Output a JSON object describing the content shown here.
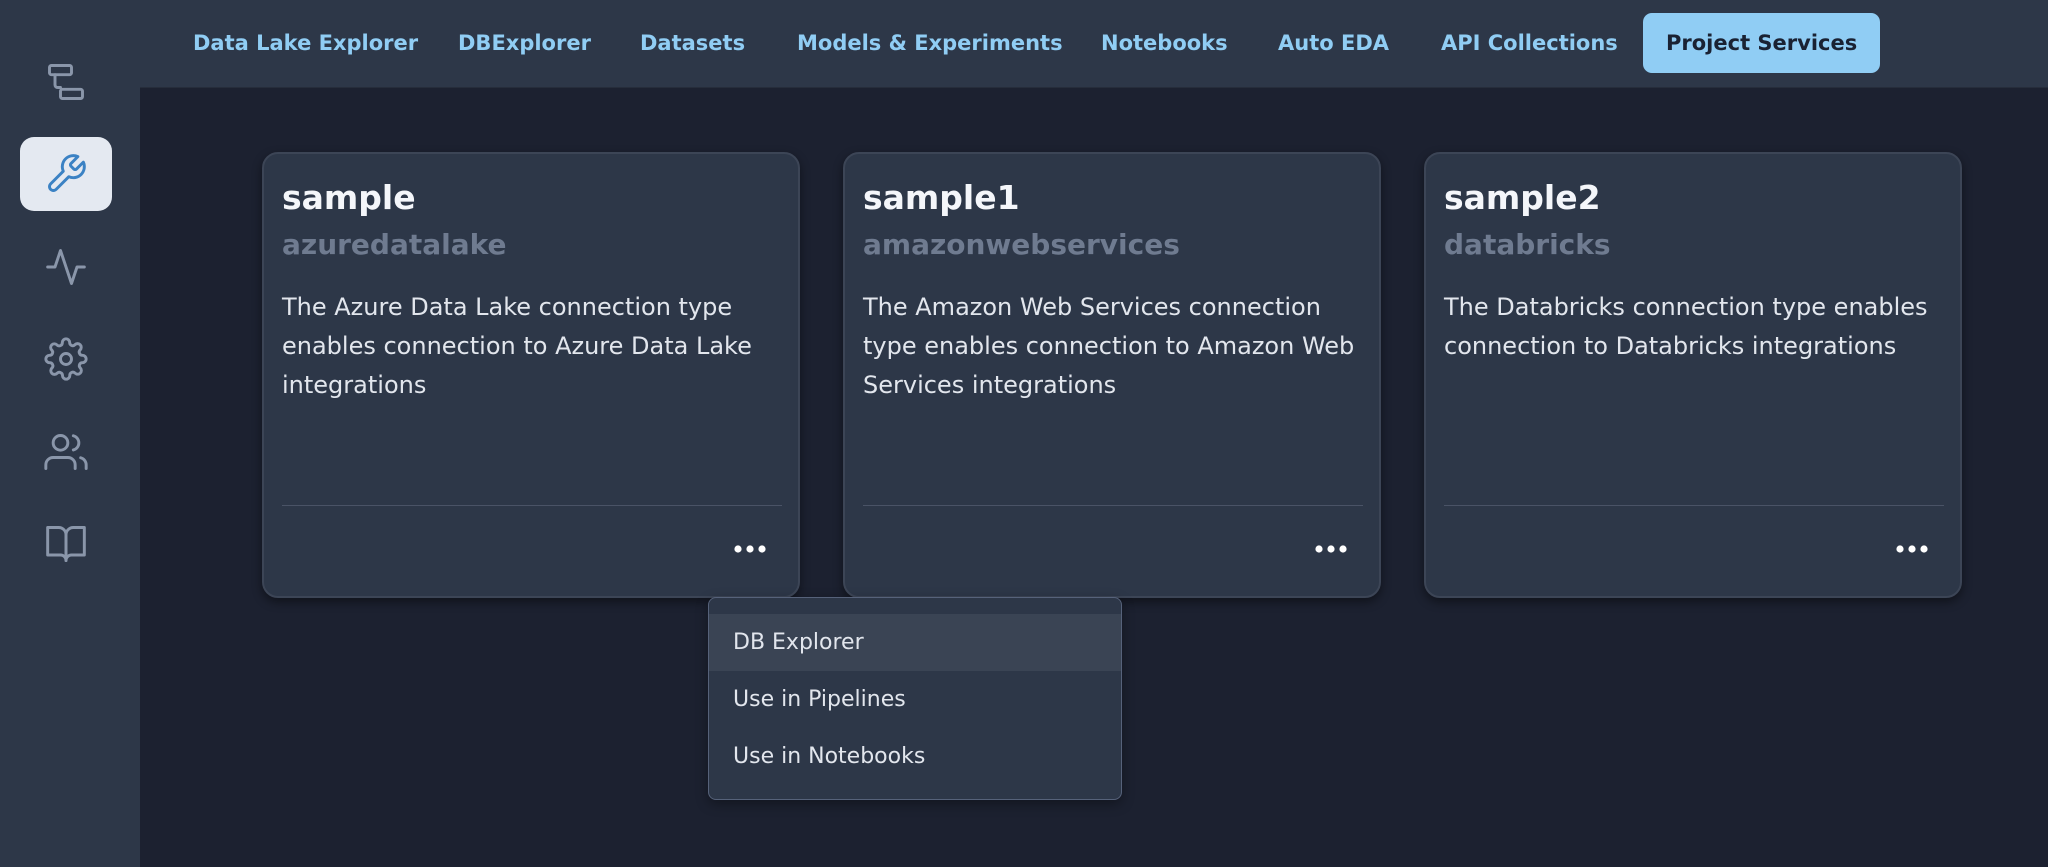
{
  "sidebar": {
    "items": [
      {
        "icon": "pipeline-icon",
        "active": false
      },
      {
        "icon": "wrench-icon",
        "active": true
      },
      {
        "icon": "activity-icon",
        "active": false
      },
      {
        "icon": "gear-icon",
        "active": false
      },
      {
        "icon": "users-icon",
        "active": false
      },
      {
        "icon": "book-icon",
        "active": false
      }
    ]
  },
  "nav": {
    "tabs": [
      {
        "label": "Data Lake Explorer"
      },
      {
        "label": "DBExplorer"
      },
      {
        "label": "Datasets"
      },
      {
        "label": "Models & Experiments"
      },
      {
        "label": "Notebooks"
      },
      {
        "label": "Auto EDA"
      },
      {
        "label": "API Collections"
      },
      {
        "label": "Project Services",
        "active": true
      }
    ]
  },
  "cards": [
    {
      "title": "sample",
      "subtitle": "azuredatalake",
      "description": "The Azure Data Lake connection type enables connection to Azure Data Lake integrations"
    },
    {
      "title": "sample1",
      "subtitle": "amazonwebservices",
      "description": "The Amazon Web Services connection type enables connection to Amazon Web Services integrations"
    },
    {
      "title": "sample2",
      "subtitle": "databricks",
      "description": "The Databricks connection type enables connection to Databricks integrations"
    }
  ],
  "menu": {
    "items": [
      {
        "label": "DB Explorer",
        "highlighted": true
      },
      {
        "label": "Use in Pipelines"
      },
      {
        "label": "Use in Notebooks"
      }
    ]
  },
  "colors": {
    "accent": "#90cdf4",
    "background": "#1c2130",
    "surface": "#2d3748",
    "icon": "#8a96aa",
    "active_icon": "#3b82c4"
  }
}
